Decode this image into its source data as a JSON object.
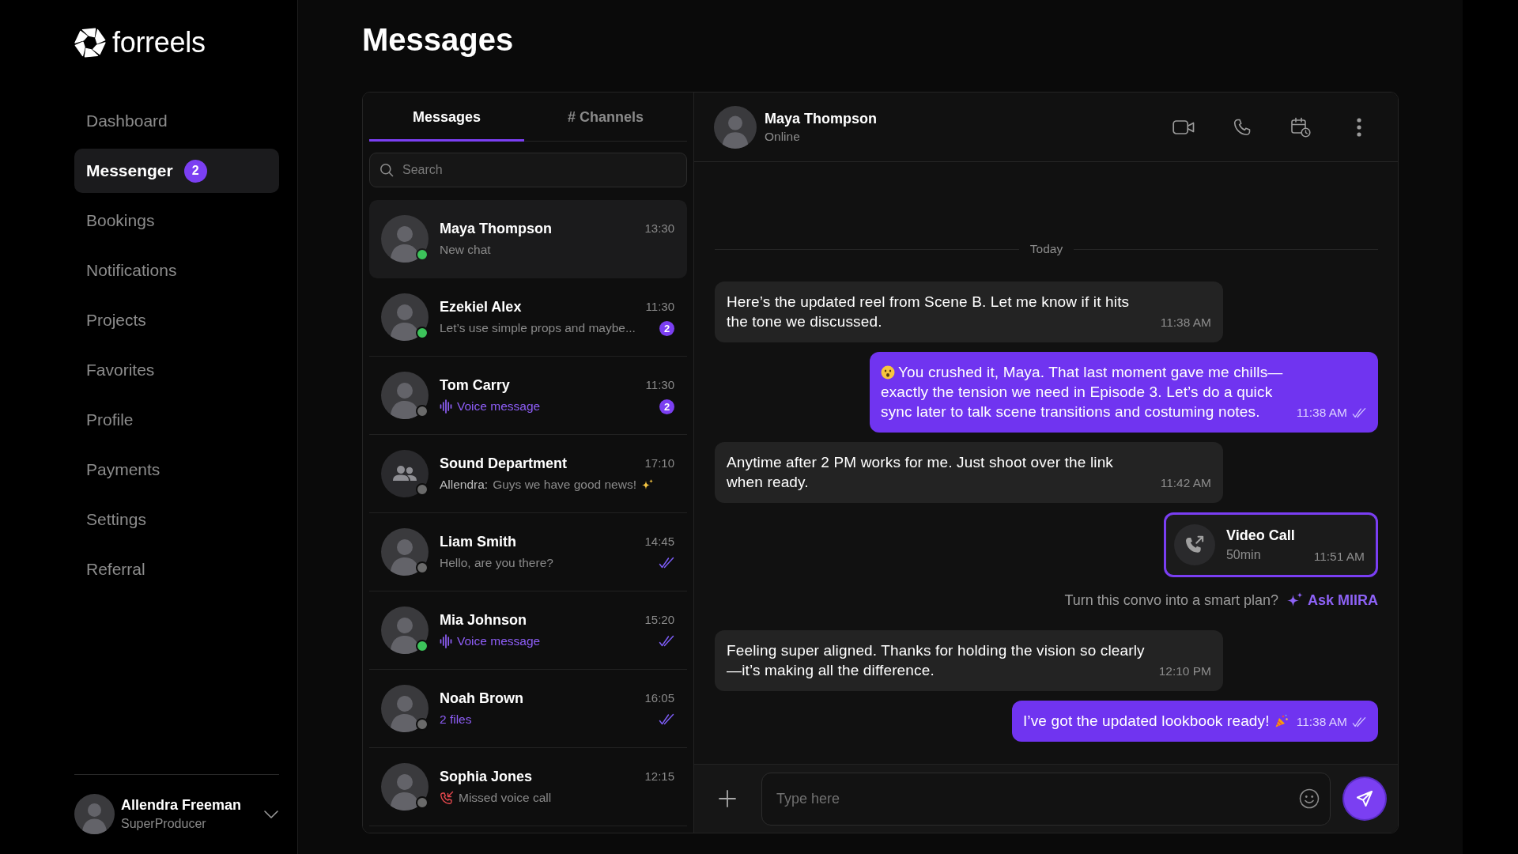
{
  "sidebar": {
    "logo": "forreels",
    "nav": [
      {
        "label": "Dashboard",
        "selected": false
      },
      {
        "label": "Messenger",
        "selected": true,
        "badge": "2"
      },
      {
        "label": "Bookings",
        "selected": false
      },
      {
        "label": "Notifications",
        "selected": false
      },
      {
        "label": "Projects",
        "selected": false
      },
      {
        "label": "Favorites",
        "selected": false
      },
      {
        "label": "Profile",
        "selected": false
      },
      {
        "label": "Payments",
        "selected": false
      },
      {
        "label": "Settings",
        "selected": false
      },
      {
        "label": "Referral",
        "selected": false
      }
    ],
    "user": {
      "name": "Allendra Freeman",
      "role": "SuperProducer"
    }
  },
  "page_title": "Messages",
  "inbox": {
    "tabs": [
      {
        "label": "Messages",
        "selected": true
      },
      {
        "label": "# Channels",
        "selected": false
      }
    ],
    "search": {
      "placeholder": "Search"
    },
    "conversations": [
      {
        "kind": "person",
        "name": "Maya Thompson",
        "time": "13:30",
        "online": true,
        "selected": true,
        "read": false,
        "preview": {
          "kind": "text",
          "text": "New chat"
        }
      },
      {
        "kind": "person",
        "name": "Ezekiel Alex",
        "time": "11:30",
        "online": true,
        "selected": false,
        "read": false,
        "unread": "2",
        "preview": {
          "kind": "text",
          "text": "Let’s use simple props and maybe..."
        }
      },
      {
        "kind": "person",
        "name": "Tom Carry",
        "time": "11:30",
        "online": false,
        "selected": false,
        "read": false,
        "unread": "2",
        "preview": {
          "kind": "voice",
          "text": "Voice message"
        }
      },
      {
        "kind": "group",
        "name": "Sound Department",
        "time": "17:10",
        "online": false,
        "selected": false,
        "read": false,
        "preview": {
          "kind": "text",
          "sender": "Allendra:",
          "text": "Guys we have good news!",
          "trail_emoji": true
        }
      },
      {
        "kind": "person",
        "name": "Liam Smith",
        "time": "14:45",
        "online": false,
        "selected": false,
        "read": true,
        "preview": {
          "kind": "text",
          "text": "Hello, are you there?"
        }
      },
      {
        "kind": "person",
        "name": "Mia Johnson",
        "time": "15:20",
        "online": true,
        "selected": false,
        "read": true,
        "preview": {
          "kind": "voice",
          "text": "Voice message"
        }
      },
      {
        "kind": "person",
        "name": "Noah Brown",
        "time": "16:05",
        "online": false,
        "selected": false,
        "read": true,
        "preview": {
          "kind": "files",
          "text": "2 files"
        }
      },
      {
        "kind": "person",
        "name": "Sophia Jones",
        "time": "12:15",
        "online": false,
        "selected": false,
        "read": false,
        "preview": {
          "kind": "missed_call",
          "text": "Missed voice call"
        }
      }
    ]
  },
  "chat": {
    "contact": {
      "name": "Maya Thompson",
      "status": "Online"
    },
    "date_divider": "Today",
    "messages": [
      {
        "kind": "text",
        "outgoing": false,
        "lead_emoji": false,
        "trail_emoji": false,
        "text": "Here’s the updated reel from Scene B. Let me know if it hits the tone we discussed.",
        "time": "11:38 AM",
        "read": false
      },
      {
        "kind": "text",
        "outgoing": true,
        "lead_emoji": true,
        "trail_emoji": false,
        "text": "You crushed it, Maya. That last moment gave me chills—exactly the tension we need in Episode 3. Let’s do a quick sync later to talk scene transitions and costuming notes.",
        "time": "11:38 AM",
        "read": true
      },
      {
        "kind": "text",
        "outgoing": false,
        "lead_emoji": false,
        "trail_emoji": false,
        "text": "Anytime after 2 PM works for me. Just shoot over the link when ready.",
        "time": "11:42 AM",
        "read": false
      },
      {
        "kind": "call",
        "outgoing": true,
        "title": "Video Call",
        "duration": "50min",
        "time": "11:51 AM",
        "read": false
      },
      {
        "kind": "suggestion",
        "text": "Turn this convo into a smart plan?",
        "action": "Ask MIIRA"
      },
      {
        "kind": "text",
        "outgoing": false,
        "lead_emoji": false,
        "trail_emoji": false,
        "text": "Feeling super aligned. Thanks for holding the vision so clearly —it’s making all the difference.",
        "time": "12:10 PM",
        "read": false
      },
      {
        "kind": "text",
        "outgoing": true,
        "lead_emoji": false,
        "trail_emoji": true,
        "text": "I’ve got the updated lookbook ready!",
        "time": "11:38 AM",
        "read": true
      }
    ],
    "composer": {
      "placeholder": "Type here"
    }
  }
}
